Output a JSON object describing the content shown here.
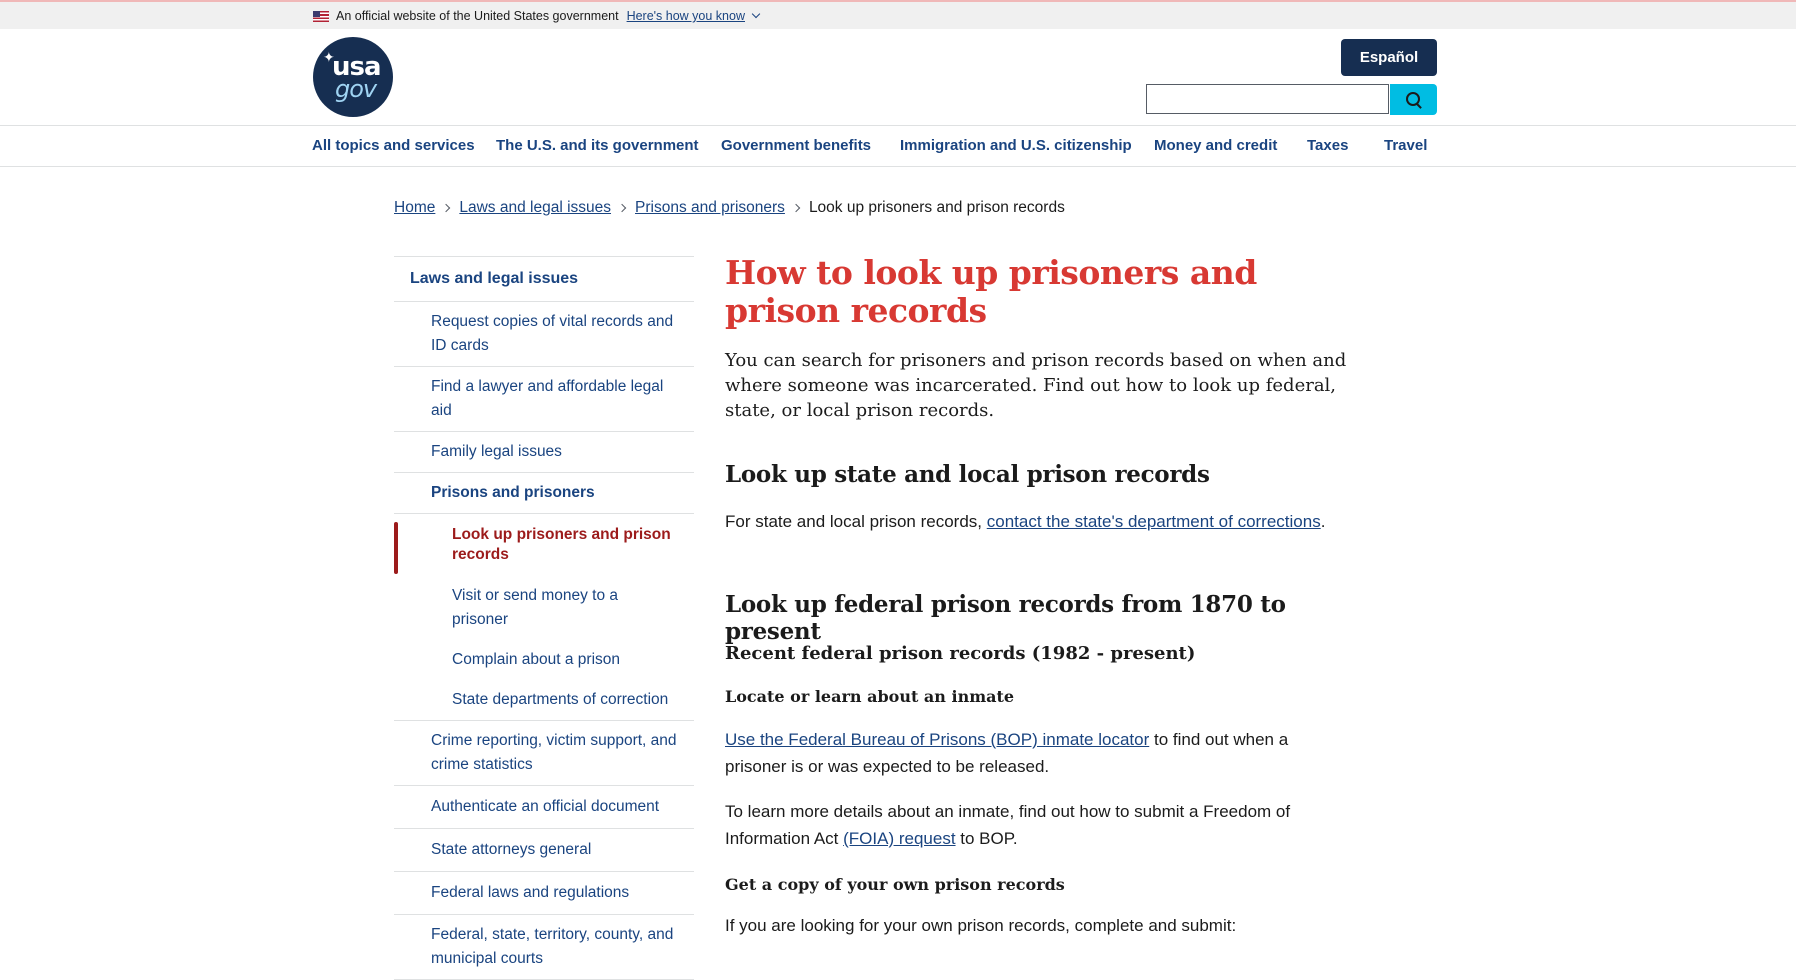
{
  "banner": {
    "text": "An official website of the United States government",
    "link": "Here's how you know"
  },
  "header": {
    "logo_top": "usa",
    "logo_bottom": "gov",
    "espanol": "Español",
    "search_value": ""
  },
  "nav": [
    "All topics and services",
    "The U.S. and its government",
    "Government benefits",
    "Immigration and U.S. citizenship",
    "Money and credit",
    "Taxes",
    "Travel"
  ],
  "breadcrumb": [
    "Home",
    "Laws and legal issues",
    "Prisons and prisoners",
    "Look up prisoners and prison records"
  ],
  "sidenav": {
    "section": "Laws and legal issues",
    "items": [
      "Request copies of vital records and ID cards",
      "Find a lawyer and affordable legal aid",
      "Family legal issues",
      "Prisons and prisoners",
      "Look up prisoners and prison records",
      "Visit or send money to a prisoner",
      "Complain about a prison",
      "State departments of correction",
      "Crime reporting, victim support, and crime statistics",
      "Authenticate an official document",
      "State attorneys general",
      "Federal laws and regulations",
      "Federal, state, territory, county, and municipal courts"
    ]
  },
  "main": {
    "title": "How to look up prisoners and prison records",
    "lead": "You can search for prisoners and prison records based on when and where someone was incarcerated. Find out how to look up federal, state, or local prison records.",
    "h2_state": "Look up state and local prison records",
    "state_text": "For state and local prison records, ",
    "state_link": "contact the state's department of corrections",
    "state_end": ".",
    "h2_federal": "Look up federal prison records from 1870 to present",
    "h3_recent": "Recent federal prison records (1982 - present)",
    "h4_locate": "Locate or learn about an inmate",
    "bop_link": "Use the Federal Bureau of Prisons (BOP) inmate locator",
    "bop_text": " to find out when a prisoner is or was expected to be released.",
    "foia_text": "To learn more details about an inmate, find out how to submit a Freedom of Information Act ",
    "foia_link": "(FOIA) request",
    "foia_end": " to BOP.",
    "h4_copy": "Get a copy of your own prison records",
    "own_text": "If you are looking for your own prison records, complete and submit:"
  }
}
